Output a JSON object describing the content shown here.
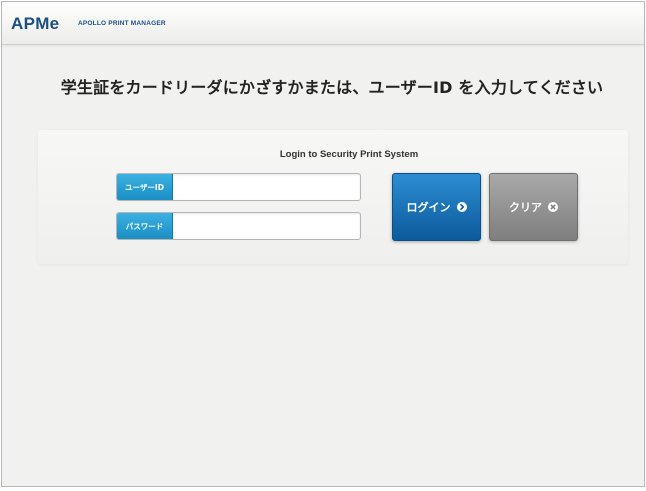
{
  "header": {
    "logo": "APMe",
    "app_name": "APOLLO PRINT MANAGER"
  },
  "instruction": "学生証をカードリーダにかざすかまたは、ユーザーID を入力してください",
  "login": {
    "title": "Login to Security Print System",
    "userid_label": "ユーザーID",
    "userid_value": "",
    "password_label": "パスワード",
    "password_value": "",
    "login_button": "ログイン",
    "clear_button": "クリア"
  },
  "icons": {
    "login_icon": "arrow-right-circle-icon",
    "clear_icon": "x-circle-icon"
  },
  "colors": {
    "brand": "#1c4f83",
    "field_label": "#1b8fc4",
    "login_button": "#0c5a9c",
    "clear_button": "#7e7e7e"
  }
}
